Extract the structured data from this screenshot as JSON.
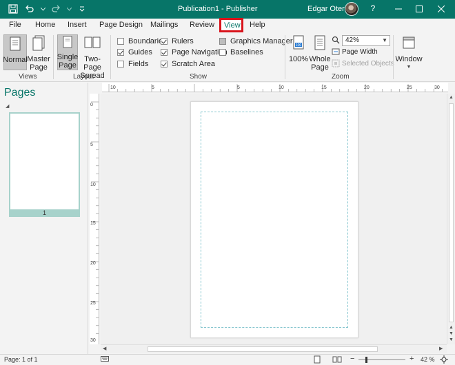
{
  "window": {
    "title": "Publication1 - Publisher",
    "user_name": "Edgar Otero",
    "help_label": "?"
  },
  "tabs": [
    {
      "label": "File"
    },
    {
      "label": "Home"
    },
    {
      "label": "Insert"
    },
    {
      "label": "Page Design"
    },
    {
      "label": "Mailings"
    },
    {
      "label": "Review"
    },
    {
      "label": "View"
    },
    {
      "label": "Help"
    }
  ],
  "ribbon": {
    "views": {
      "label": "Views",
      "normal": "Normal",
      "master_page_line1": "Master",
      "master_page_line2": "Page"
    },
    "layout": {
      "label": "Layout",
      "single_line1": "Single",
      "single_line2": "Page",
      "two_line1": "Two-Page",
      "two_line2": "Spread"
    },
    "show": {
      "label": "Show",
      "boundaries": "Boundaries",
      "guides": "Guides",
      "fields": "Fields",
      "rulers": "Rulers",
      "page_navigation": "Page Navigation",
      "scratch_area": "Scratch Area",
      "graphics_manager": "Graphics Manager",
      "baselines": "Baselines"
    },
    "zoom": {
      "label": "Zoom",
      "btn_100": "100%",
      "whole_line1": "Whole",
      "whole_line2": "Page",
      "zoom_value": "42%",
      "page_width": "Page Width",
      "selected_objects": "Selected Objects"
    },
    "window": {
      "label": "Window"
    }
  },
  "pages_pane": {
    "title": "Pages",
    "thumb_number": "1"
  },
  "ruler": {
    "h_labels": [
      "10",
      "5",
      "5",
      "10",
      "15",
      "20",
      "25",
      "30"
    ],
    "v_labels": [
      "0",
      "5",
      "10",
      "15",
      "20",
      "25",
      "30"
    ]
  },
  "status": {
    "page_info": "Page: 1 of 1",
    "zoom": "42 %"
  },
  "colors": {
    "accent": "#077568",
    "highlight": "#d9141c"
  }
}
